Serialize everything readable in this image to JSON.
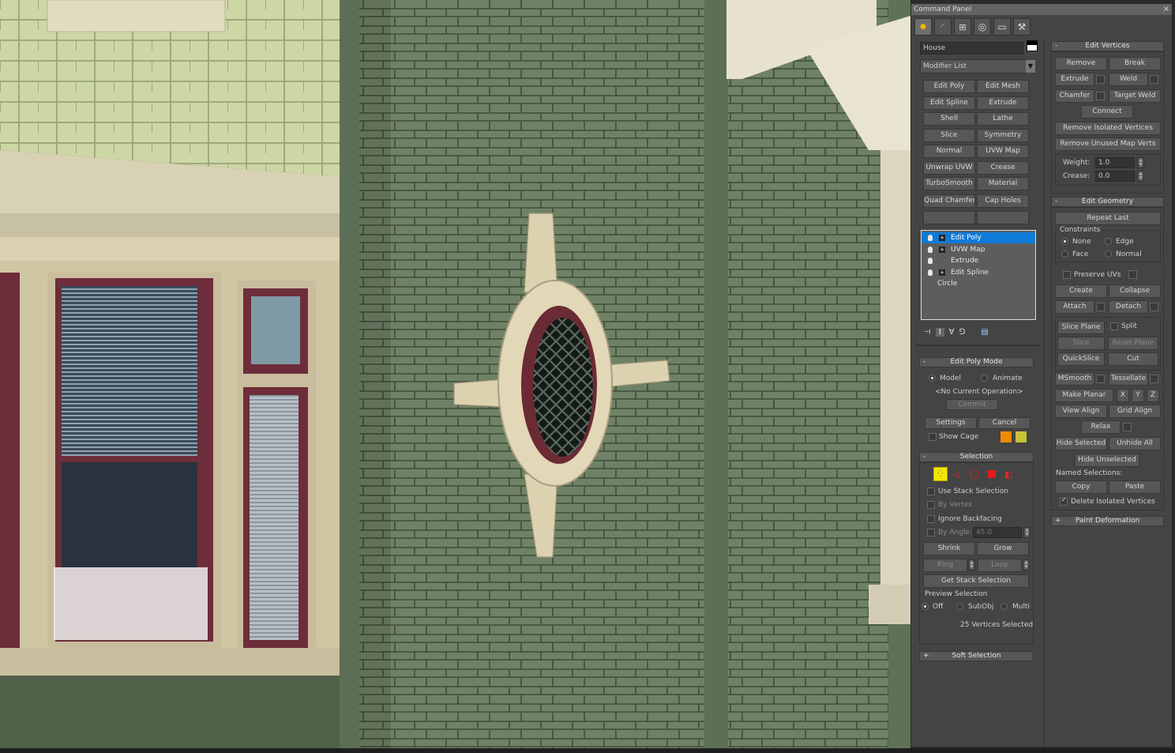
{
  "panel": {
    "title": "Command Panel",
    "close": "×",
    "tab_icons": [
      "sun-icon",
      "curve-icon",
      "hierarchy-icon",
      "motion-icon",
      "display-icon",
      "hammer-icon"
    ],
    "object_name": "House",
    "modifier_list": "Modifier List"
  },
  "modifier_buttons": [
    [
      "Edit Poly",
      "Edit Mesh"
    ],
    [
      "Edit Spline",
      "Extrude"
    ],
    [
      "Shell",
      "Lathe"
    ],
    [
      "Slice",
      "Symmetry"
    ],
    [
      "Normal",
      "UVW Map"
    ],
    [
      "Unwrap UVW",
      "Crease"
    ],
    [
      "TurboSmooth",
      "Material"
    ],
    [
      "Quad Chamfer",
      "Cap Holes"
    ],
    [
      "",
      ""
    ]
  ],
  "stack": [
    {
      "label": "Edit Poly",
      "selected": true
    },
    {
      "label": "UVW Map",
      "selected": false
    },
    {
      "label": "Extrude",
      "selected": false
    },
    {
      "label": "Edit Spline",
      "selected": false
    },
    {
      "label": "Circle",
      "selected": false
    }
  ],
  "stack_tools": [
    "pin-icon",
    "show-end-result-icon",
    "make-unique-icon",
    "remove-modifier-icon",
    "configure-icon"
  ],
  "edit_poly_mode": {
    "header": "Edit Poly Mode",
    "model": "Model",
    "animate": "Animate",
    "current_op": "<No Current Operation>",
    "commit": "Commit",
    "settings": "Settings",
    "cancel": "Cancel",
    "show_cage": "Show Cage",
    "cage_colors": [
      "#f08a00",
      "#c9c233"
    ]
  },
  "selection": {
    "header": "Selection",
    "use_stack": "Use Stack Selection",
    "by_vertex": "By Vertex",
    "ignore_backfacing": "Ignore Backfacing",
    "by_angle": "By Angle:",
    "angle_value": "45.0",
    "shrink": "Shrink",
    "grow": "Grow",
    "ring": "Ring",
    "loop": "Loop",
    "get_stack": "Get Stack Selection",
    "preview": "Preview Selection",
    "off": "Off",
    "subobj": "SubObj",
    "multi": "Multi",
    "status": "25 Vertices Selected"
  },
  "soft_selection": {
    "header": "Soft Selection"
  },
  "edit_vertices": {
    "header": "Edit Vertices",
    "remove": "Remove",
    "break": "Break",
    "extrude": "Extrude",
    "weld": "Weld",
    "chamfer": "Chamfer",
    "target_weld": "Target Weld",
    "connect": "Connect",
    "remove_isolated": "Remove Isolated Vertices",
    "remove_unused": "Remove Unused Map Verts",
    "weight_label": "Weight:",
    "weight": "1.0",
    "crease_label": "Crease:",
    "crease": "0.0"
  },
  "edit_geometry": {
    "header": "Edit Geometry",
    "repeat_last": "Repeat Last",
    "constraints": "Constraints",
    "none": "None",
    "edge": "Edge",
    "face": "Face",
    "normal": "Normal",
    "preserve_uvs": "Preserve UVs",
    "create": "Create",
    "collapse": "Collapse",
    "attach": "Attach",
    "detach": "Detach",
    "slice_plane": "Slice Plane",
    "split": "Split",
    "slice": "Slice",
    "reset_plane": "Reset Plane",
    "quickslice": "QuickSlice",
    "cut": "Cut",
    "msmooth": "MSmooth",
    "tessellate": "Tessellate",
    "make_planar": "Make Planar",
    "x": "X",
    "y": "Y",
    "z": "Z",
    "view_align": "View Align",
    "grid_align": "Grid Align",
    "relax": "Relax",
    "hide_selected": "Hide Selected",
    "unhide_all": "Unhide All",
    "hide_unselected": "Hide Unselected",
    "named_selections": "Named Selections:",
    "copy": "Copy",
    "paste": "Paste",
    "delete_isolated": "Delete Isolated Vertices"
  },
  "paint_deformation": {
    "header": "Paint Deformation"
  }
}
